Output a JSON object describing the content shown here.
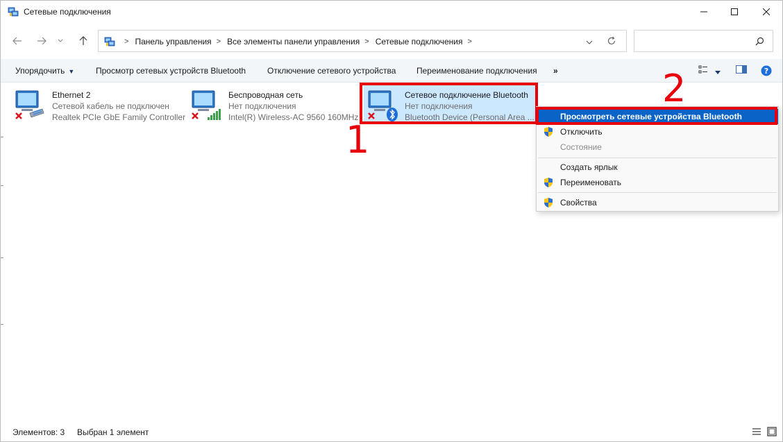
{
  "window": {
    "title": "Сетевые подключения"
  },
  "address": {
    "crumbs": [
      "Панель управления",
      "Все элементы панели управления",
      "Сетевые подключения"
    ],
    "search_placeholder": ""
  },
  "toolbar": {
    "organize": "Упорядочить",
    "view_bt": "Просмотр сетевых устройств Bluetooth",
    "disable": "Отключение сетевого устройства",
    "rename": "Переименование подключения",
    "more": "»"
  },
  "connections": [
    {
      "name": "Ethernet 2",
      "status": "Сетевой кабель не подключен",
      "device": "Realtek PCIe GbE Family Controller",
      "icon": "ethernet-adapter-icon"
    },
    {
      "name": "Беспроводная сеть",
      "status": "Нет подключения",
      "device": "Intel(R) Wireless-AC 9560 160MHz",
      "icon": "wireless-adapter-icon"
    },
    {
      "name": "Сетевое подключение Bluetooth",
      "status": "Нет подключения",
      "device": "Bluetooth Device (Personal Area ...",
      "icon": "bluetooth-adapter-icon"
    }
  ],
  "annotations": {
    "step1": "1",
    "step2": "2"
  },
  "context_menu": {
    "items": [
      {
        "label": "Просмотреть сетевые устройства Bluetooth",
        "highlighted": true,
        "disabled": false,
        "shield": false
      },
      {
        "label": "Отключить",
        "highlighted": false,
        "disabled": false,
        "shield": true
      },
      {
        "label": "Состояние",
        "highlighted": false,
        "disabled": true,
        "shield": false
      },
      {
        "label": "Создать ярлык",
        "highlighted": false,
        "disabled": false,
        "shield": false
      },
      {
        "label": "Переименовать",
        "highlighted": false,
        "disabled": false,
        "shield": true
      },
      {
        "label": "Свойства",
        "highlighted": false,
        "disabled": false,
        "shield": true
      }
    ]
  },
  "statusbar": {
    "count": "Элементов: 3",
    "selected": "Выбран 1 элемент"
  },
  "colors": {
    "selection": "#cce8ff",
    "menu_highlight": "#0a64c8",
    "annotation_red": "#e8000b",
    "disconnect_x": "#d8161e"
  }
}
